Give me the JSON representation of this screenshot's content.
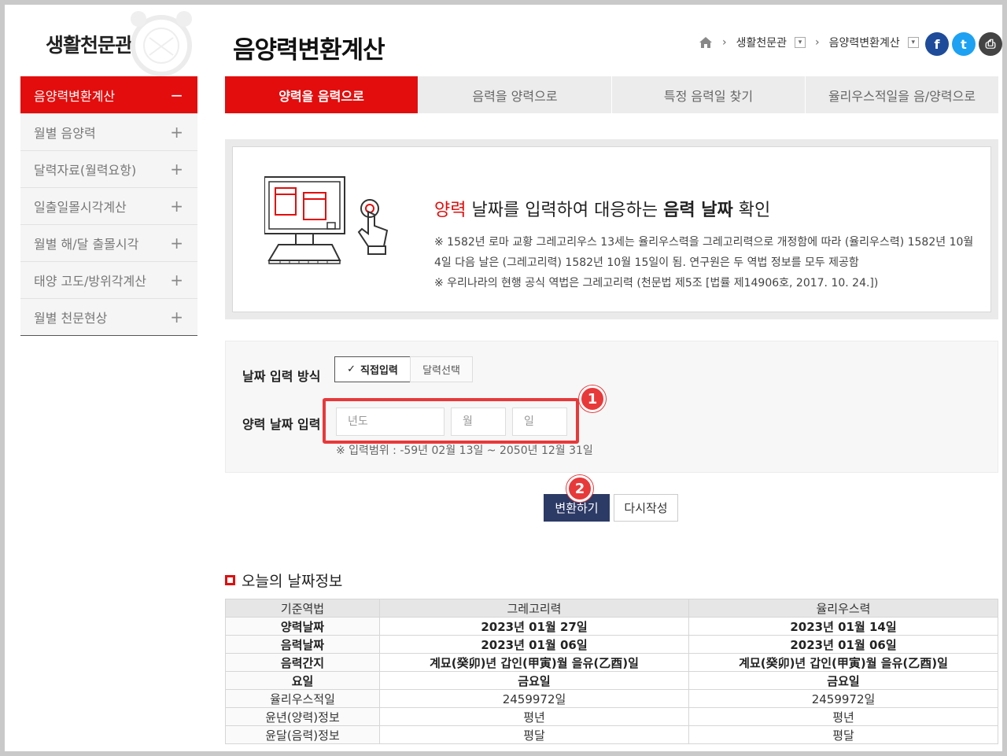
{
  "sidebar": {
    "logo": "생활천문관",
    "items": [
      {
        "label": "음양력변환계산",
        "sign": "−",
        "active": true
      },
      {
        "label": "월별 음양력",
        "sign": "+"
      },
      {
        "label": "달력자료(월력요항)",
        "sign": "+"
      },
      {
        "label": "일출일몰시각계산",
        "sign": "+"
      },
      {
        "label": "월별 해/달 출몰시각",
        "sign": "+"
      },
      {
        "label": "태양 고도/방위각계산",
        "sign": "+"
      },
      {
        "label": "월별 천문현상",
        "sign": "+"
      }
    ]
  },
  "header": {
    "title": "음양력변환계산",
    "breadcrumb": {
      "level1": "생활천문관",
      "level2": "음양력변환계산"
    },
    "social": {
      "facebook": "f",
      "twitter": "t",
      "print": "⎙"
    }
  },
  "tabs": [
    {
      "label": "양력을 음력으로",
      "active": true
    },
    {
      "label": "음력을 양력으로"
    },
    {
      "label": "특정 음력일 찾기"
    },
    {
      "label": "율리우스적일을 음/양력으로"
    }
  ],
  "info": {
    "headline_red": "양력",
    "headline_1": " 날짜를 입력하여 대응하는 ",
    "headline_bold": "음력 날짜",
    "headline_2": " 확인",
    "note1": "※ 1582년 로마 교황 그레고리우스 13세는 율리우스력을 그레고리력으로 개정함에 따라 (율리우스력) 1582년 10월 4일 다음 날은 (그레고리력) 1582년 10월 15일이 됨. 연구원은 두 역법 정보를 모두 제공함",
    "note2": "※ 우리나라의 현행 공식 역법은 그레고리력 (천문법 제5조 [법률 제14906호, 2017. 10. 24.])"
  },
  "form": {
    "mode_label": "날짜 입력 방식",
    "mode_direct": "직접입력",
    "mode_calendar": "달력선택",
    "date_label": "양력 날짜 입력",
    "year_placeholder": "년도",
    "month_placeholder": "월",
    "day_placeholder": "일",
    "range_note": "※ 입력범위 : -59년 02월 13일 ~ 2050년 12월 31일",
    "badge1": "1",
    "badge2": "2",
    "convert_label": "변환하기",
    "reset_label": "다시작성"
  },
  "today": {
    "title": "오늘의 날짜정보",
    "headers": [
      "기준역법",
      "그레고리력",
      "율리우스력"
    ],
    "rows": [
      [
        "양력날짜",
        "2023년 01월 27일",
        "2023년 01월 14일"
      ],
      [
        "음력날짜",
        "2023년 01월 06일",
        "2023년 01월 06일"
      ],
      [
        "음력간지",
        "계묘(癸卯)년 갑인(甲寅)월 을유(乙酉)일",
        "계묘(癸卯)년 갑인(甲寅)월 을유(乙酉)일"
      ],
      [
        "요일",
        "금요일",
        "금요일"
      ],
      [
        "율리우스적일",
        "2459972일",
        "2459972일"
      ],
      [
        "윤년(양력)정보",
        "평년",
        "평년"
      ],
      [
        "윤달(음력)정보",
        "평달",
        "평달"
      ]
    ]
  }
}
